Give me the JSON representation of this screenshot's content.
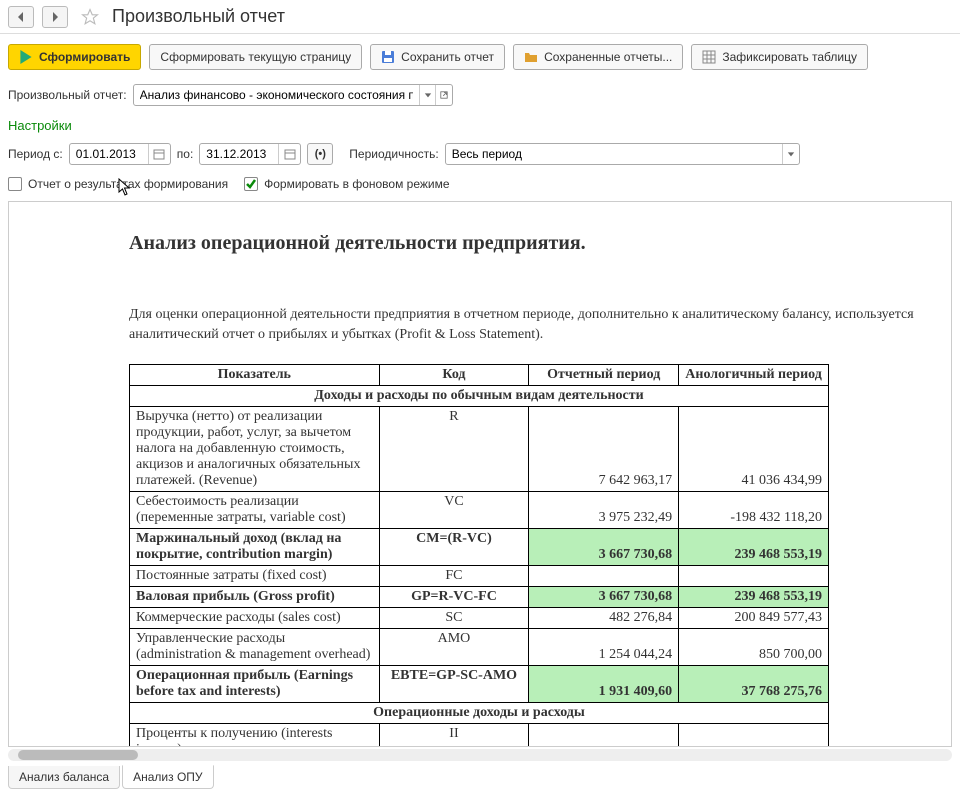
{
  "header": {
    "title": "Произвольный отчет"
  },
  "toolbar": {
    "generate": "Сформировать",
    "generate_page": "Сформировать текущую страницу",
    "save": "Сохранить отчет",
    "saved_reports": "Сохраненные отчеты...",
    "fix_table": "Зафиксировать таблицу"
  },
  "selector": {
    "label": "Произвольный отчет:",
    "value": "Анализ финансово - экономического состояния предприяти"
  },
  "settings_title": "Настройки",
  "params": {
    "period_from_label": "Период с:",
    "period_from": "01.01.2013",
    "period_to_label": "по:",
    "period_to": "31.12.2013",
    "periodicity_label": "Периодичность:",
    "periodicity_value": "Весь период"
  },
  "checkboxes": {
    "results": {
      "label": "Отчет о результатах формирования",
      "checked": false
    },
    "background": {
      "label": "Формировать в фоновом режиме",
      "checked": true
    }
  },
  "report": {
    "title": "Анализ операционной деятельности предприятия.",
    "intro": "Для оценки операционной деятельности предприятия в отчетном периоде, дополнительно к аналитическому балансу, используется аналитический отчет о прибылях и убытках (Profit & Loss Statement).",
    "columns": {
      "indicator": "Показатель",
      "code": "Код",
      "report_period": "Отчетный период",
      "analog_period": "Анологичный период"
    },
    "section1": "Доходы и расходы по обычным видам деятельности",
    "rows": [
      {
        "ind": "Выручка (нетто) от реализации продукции, работ, услуг, за вычетом налога на добавленную стоимость, акцизов и аналогичных обязательных платежей. (Revenue)",
        "code": "R",
        "rp": "7 642 963,17",
        "ap": "41 036 434,99",
        "bold": false,
        "hl": false
      },
      {
        "ind": "Себестоимость реализации (переменные затраты, variable cost)",
        "code": "VC",
        "rp": "3 975 232,49",
        "ap": "-198 432 118,20",
        "bold": false,
        "hl": false
      },
      {
        "ind": "Маржинальный доход (вклад на покрытие, contribution margin)",
        "code": "CM=(R-VC)",
        "rp": "3 667 730,68",
        "ap": "239 468 553,19",
        "bold": true,
        "hl": true
      },
      {
        "ind": "Постоянные затраты (fixed cost)",
        "code": "FC",
        "rp": "",
        "ap": "",
        "bold": false,
        "hl": false
      },
      {
        "ind": "Валовая прибыль (Gross profit)",
        "code": "GP=R-VC-FC",
        "rp": "3 667 730,68",
        "ap": "239 468 553,19",
        "bold": true,
        "hl": true
      },
      {
        "ind": "Коммерческие расходы (sales cost)",
        "code": "SC",
        "rp": "482 276,84",
        "ap": "200 849 577,43",
        "bold": false,
        "hl": false
      },
      {
        "ind": "Управленческие расходы (administration & management overhead)",
        "code": "AMO",
        "rp": "1 254 044,24",
        "ap": "850 700,00",
        "bold": false,
        "hl": false
      },
      {
        "ind": "Операционная прибыль (Earnings before tax and interests)",
        "code": "EBTE=GP-SC-AMO",
        "rp": "1 931 409,60",
        "ap": "37 768 275,76",
        "bold": true,
        "hl": true
      }
    ],
    "section2": "Операционные доходы и расходы",
    "row_after": {
      "ind": "Проценты к получению (interests income)",
      "code": "II"
    }
  },
  "tabs": {
    "t1": "Анализ баланса",
    "t2": "Анализ ОПУ"
  }
}
